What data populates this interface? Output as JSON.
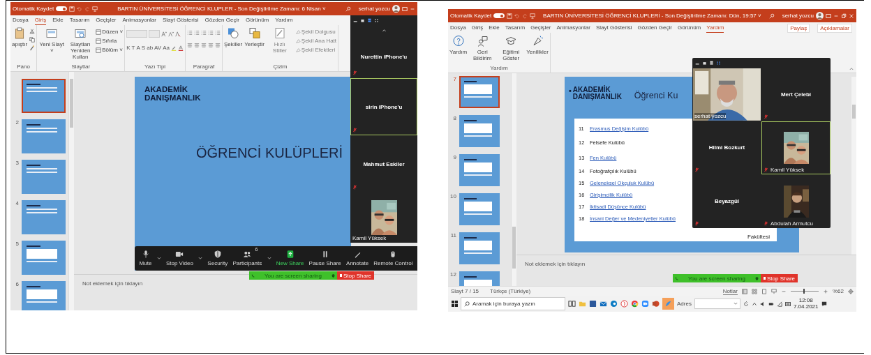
{
  "left_window": {
    "title_bar": {
      "autosave_label": "Otomatik Kaydet",
      "autosave_on": true,
      "title": "BARTIN ÜNİVERSİTESİ ÖĞRENCİ KLUPLER  -  Son Değiştirilme Zamanı: 6 Nisan ˅",
      "user": "serhat yozcu"
    },
    "tabs": [
      {
        "label": "Dosya",
        "selected": false
      },
      {
        "label": "Giriş",
        "selected": true
      },
      {
        "label": "Ekle",
        "selected": false
      },
      {
        "label": "Tasarım",
        "selected": false
      },
      {
        "label": "Geçişler",
        "selected": false
      },
      {
        "label": "Animasyonlar",
        "selected": false
      },
      {
        "label": "Slayt Gösterisi",
        "selected": false
      },
      {
        "label": "Gözden Geçir",
        "selected": false
      },
      {
        "label": "Görünüm",
        "selected": false
      },
      {
        "label": "Yardım",
        "selected": false
      }
    ],
    "ribbon_groups": [
      {
        "label": "Pano",
        "kind": "clipboard",
        "buttons": [
          "apıştır"
        ]
      },
      {
        "label": "Slaytlar",
        "kind": "slides",
        "buttons": [
          "Yeni Slayt ˅",
          "Slaytları Yeniden Kullan"
        ],
        "small_buttons": [
          "Düzen ˅",
          "Sıfırla",
          "Bölüm ˅"
        ]
      },
      {
        "label": "Yazı Tipi",
        "kind": "font",
        "buttons": [
          "K",
          "T",
          "A",
          "S",
          "ab",
          "AV",
          "Aa"
        ]
      },
      {
        "label": "Paragraf",
        "kind": "paragraph"
      },
      {
        "label": "Çizim",
        "kind": "drawing",
        "buttons": [
          "Şekiller",
          "Yerleştir",
          "Hızlı Stiller"
        ],
        "small_buttons": [
          "Şekil Dolgusu",
          "Şekil Ana Hatt",
          "Şekil Efektleri"
        ]
      }
    ],
    "thumbnails": [
      {
        "selected": true
      },
      {
        "number": "2",
        "selected": false
      },
      {
        "number": "3",
        "selected": false
      },
      {
        "number": "4",
        "selected": false
      },
      {
        "number": "5",
        "selected": false
      },
      {
        "number": "6",
        "selected": false
      }
    ],
    "slide": {
      "heading": "AKADEMİK DANIŞMANLIK",
      "title": "ÖĞRENCİ KULÜPLERİ"
    },
    "notes_placeholder": "Not eklemek için tıklayın",
    "participants": [
      {
        "name": "Nurettin iPhone'u",
        "kind": "name",
        "speaking": false
      },
      {
        "name": "sirin iPhone'u",
        "kind": "name",
        "speaking": true
      },
      {
        "name": "Mahmut Eskiler",
        "kind": "name",
        "speaking": false
      },
      {
        "name": "Kamil Yüksek",
        "kind": "video",
        "speaking": false
      }
    ],
    "zoom_toolbar": [
      {
        "label": "Mute",
        "kind": "mic"
      },
      {
        "label": "Stop Video",
        "kind": "camera"
      },
      {
        "label": "Security",
        "kind": "shield"
      },
      {
        "label": "Participants",
        "kind": "people",
        "count": "6"
      },
      {
        "label": "New Share",
        "kind": "share"
      },
      {
        "label": "Pause Share",
        "kind": "pause"
      },
      {
        "label": "Annotate",
        "kind": "pen"
      },
      {
        "label": "Remote Control",
        "kind": "mouse"
      }
    ],
    "share_bar": {
      "status": "You are screen sharing",
      "stop": "Stop Share"
    }
  },
  "right_window": {
    "title_bar": {
      "autosave_label": "Otomatik Kaydet",
      "autosave_on": true,
      "title": "BARTIN ÜNİVERSİTESİ ÖĞRENCİ KLUPLERİ  -  Son Değiştirilme Zamanı: Dün, 19:57 ˅",
      "user": "serhat yozcu"
    },
    "tabs": [
      {
        "label": "Dosya",
        "selected": false
      },
      {
        "label": "Giriş",
        "selected": false
      },
      {
        "label": "Ekle",
        "selected": false
      },
      {
        "label": "Tasarım",
        "selected": false
      },
      {
        "label": "Geçişler",
        "selected": false
      },
      {
        "label": "Animasyonlar",
        "selected": false
      },
      {
        "label": "Slayt Gösterisi",
        "selected": false
      },
      {
        "label": "Gözden Geçir",
        "selected": false
      },
      {
        "label": "Görünüm",
        "selected": false
      },
      {
        "label": "Yardım",
        "selected": true
      }
    ],
    "header_buttons": [
      "Paylaş",
      "Açıklamalar"
    ],
    "ribbon_group": {
      "label": "Yardım",
      "buttons": [
        {
          "label": "Yardım",
          "kind": "help"
        },
        {
          "label": "Geri Bildirim",
          "kind": "feedback"
        },
        {
          "label": "Eğitimi Göster",
          "kind": "training"
        },
        {
          "label": "Yenilikler",
          "kind": "new"
        }
      ]
    },
    "thumbnails": [
      {
        "number": "7",
        "selected": true
      },
      {
        "number": "8",
        "selected": false
      },
      {
        "number": "9",
        "selected": false
      },
      {
        "number": "10",
        "selected": false
      },
      {
        "number": "11",
        "selected": false
      },
      {
        "number": "12",
        "selected": false
      }
    ],
    "slide": {
      "bullet": "•",
      "heading": "AKADEMİK DANIŞMANLIK",
      "title": "Öğrenci Ku",
      "fragment": "Fakültesi",
      "rows": [
        {
          "number": "11",
          "name": "Erasmus Değişim Kulübü",
          "link": true
        },
        {
          "number": "12",
          "name": "Felsefe Kulübü",
          "link": false
        },
        {
          "number": "13",
          "name": "Fen Kulübü",
          "link": true
        },
        {
          "number": "14",
          "name": "Fotoğrafçılık Kulübü",
          "link": false
        },
        {
          "number": "15",
          "name": "Geleneksel Okçuluk Kulübü",
          "link": true
        },
        {
          "number": "16",
          "name": "Girişimcilik Kulübü",
          "link": true
        },
        {
          "number": "17",
          "name": "İktisadi Düşünce Kulübü",
          "link": true
        },
        {
          "number": "18",
          "name": "İnsani Değer ve Medeniyetler Kulübü",
          "link": true
        }
      ]
    },
    "gallery": [
      {
        "name": "serhat yozcu",
        "kind": "video",
        "speaking": false
      },
      {
        "name": "Mert Çelebi",
        "kind": "name",
        "speaking": false
      },
      {
        "name": "Hilmi Bozkurt",
        "kind": "name",
        "speaking": false
      },
      {
        "name": "Kamil Yüksek",
        "kind": "video",
        "speaking": true
      },
      {
        "name": "Beyazgül",
        "kind": "name",
        "speaking": false
      },
      {
        "name": "Abdulah Armutcu",
        "kind": "video",
        "speaking": false
      }
    ],
    "notes_placeholder": "Not eklemek için tıklayın",
    "share_bar": {
      "status": "You are screen sharing",
      "stop": "Stop Share"
    },
    "status_bar": {
      "slide": "Slayt 7 / 15",
      "language": "Türkçe (Türkiye)",
      "notes": "Notlar",
      "zoom": "%62",
      "level": 0.45
    },
    "taskbar": {
      "search_placeholder": "Aramak için buraya yazın",
      "address_label": "Adres",
      "time": "12:08",
      "date": "7.04.2021"
    }
  }
}
